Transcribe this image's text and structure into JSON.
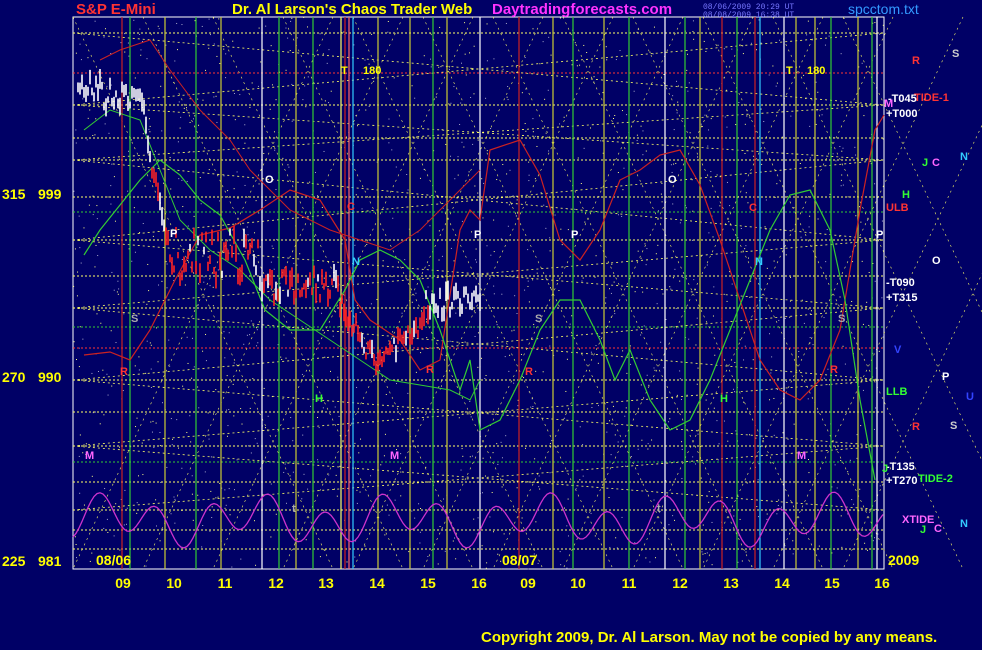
{
  "header": {
    "symbol": "S&P E-Mini",
    "title": "Dr. Al Larson's Chaos Trader Web",
    "site": "Daytradingforecasts.com",
    "stamp1": "08/06/2009 20:29 UT",
    "stamp2": "08/08/2009 16:38 UT",
    "file": "spcctom.txt"
  },
  "footer": {
    "copyright": "Copyright 2009, Dr. Al Larson. May not be copied by any means."
  },
  "colors": {
    "background": "#000066",
    "grid": "#ffff66",
    "green": "#33cc33",
    "red": "#cc2222",
    "magenta": "#cc33cc",
    "white": "#ffffff",
    "blue": "#2233ff",
    "yellow": "#ffff00"
  },
  "chart_data": {
    "type": "line",
    "y_left_labels": [
      {
        "angle": "315",
        "price": "999"
      },
      {
        "angle": "270",
        "price": "990"
      },
      {
        "angle": "225",
        "price": "981"
      }
    ],
    "x_hours": [
      "09",
      "10",
      "11",
      "12",
      "13",
      "14",
      "15",
      "16",
      "09",
      "10",
      "11",
      "12",
      "13",
      "14",
      "15",
      "16"
    ],
    "date_labels": [
      "08/06",
      "08/07",
      "2009"
    ],
    "right_labels": [
      {
        "text": "TIDE-1",
        "color": "#ff3333"
      },
      {
        "text": "-T045",
        "color": "#ffffff"
      },
      {
        "text": "+T000",
        "color": "#ffffff"
      },
      {
        "text": "ULB",
        "color": "#ff3333"
      },
      {
        "text": "-T090",
        "color": "#ffffff"
      },
      {
        "text": "+T315",
        "color": "#ffffff"
      },
      {
        "text": "LLB",
        "color": "#33ff33"
      },
      {
        "text": "-T135",
        "color": "#ffffff"
      },
      {
        "text": "+T270",
        "color": "#ffffff"
      },
      {
        "text": "TIDE-2",
        "color": "#33ff33"
      },
      {
        "text": "XTIDE",
        "color": "#ff66ff"
      }
    ],
    "planet_letters": [
      {
        "t": "R",
        "c": "#ff3333"
      },
      {
        "t": "S",
        "c": "#cccccc"
      },
      {
        "t": "M",
        "c": "#ff66ff"
      },
      {
        "t": "J",
        "c": "#33ff33"
      },
      {
        "t": "C",
        "c": "#ff66ff"
      },
      {
        "t": "N",
        "c": "#33ccff"
      },
      {
        "t": "H",
        "c": "#33ff33"
      },
      {
        "t": "O",
        "c": "#ffffff"
      },
      {
        "t": "V",
        "c": "#3344ff"
      },
      {
        "t": "P",
        "c": "#ffffff"
      },
      {
        "t": "U",
        "c": "#3344ff"
      },
      {
        "t": "S",
        "c": "#cccccc"
      },
      {
        "t": "R",
        "c": "#ff3333"
      },
      {
        "t": "J",
        "c": "#33ff33"
      },
      {
        "t": "C",
        "c": "#ff66ff"
      },
      {
        "t": "N",
        "c": "#33ccff"
      }
    ],
    "in_chart_letters": [
      {
        "t": "T",
        "c": "#ffff00"
      },
      {
        "t": "180",
        "c": "#ffff00"
      },
      {
        "t": "T",
        "c": "#ffff00"
      },
      {
        "t": "180",
        "c": "#ffff00"
      },
      {
        "t": "O",
        "c": "#ffffff"
      },
      {
        "t": "O",
        "c": "#ffffff"
      },
      {
        "t": "P",
        "c": "#ffffff"
      },
      {
        "t": "P",
        "c": "#ffffff"
      },
      {
        "t": "P",
        "c": "#ffffff"
      },
      {
        "t": "P",
        "c": "#ffffff"
      },
      {
        "t": "C",
        "c": "#ff3333"
      },
      {
        "t": "C",
        "c": "#ff3333"
      },
      {
        "t": "N",
        "c": "#33ccff"
      },
      {
        "t": "N",
        "c": "#33ccff"
      },
      {
        "t": "S",
        "c": "#aaaaaa"
      },
      {
        "t": "S",
        "c": "#aaaaaa"
      },
      {
        "t": "S",
        "c": "#aaaaaa"
      },
      {
        "t": "R",
        "c": "#ff3333"
      },
      {
        "t": "R",
        "c": "#ff3333"
      },
      {
        "t": "R",
        "c": "#ff3333"
      },
      {
        "t": "R",
        "c": "#ff3333"
      },
      {
        "t": "H",
        "c": "#33ff33"
      },
      {
        "t": "H",
        "c": "#33ff33"
      },
      {
        "t": "M",
        "c": "#ff66ff"
      },
      {
        "t": "M",
        "c": "#ff66ff"
      },
      {
        "t": "M",
        "c": "#ff66ff"
      },
      {
        "t": "t",
        "c": "#aaaaaa"
      },
      {
        "t": "t",
        "c": "#aaaaaa"
      },
      {
        "t": "J",
        "c": "#33ff33"
      }
    ]
  }
}
